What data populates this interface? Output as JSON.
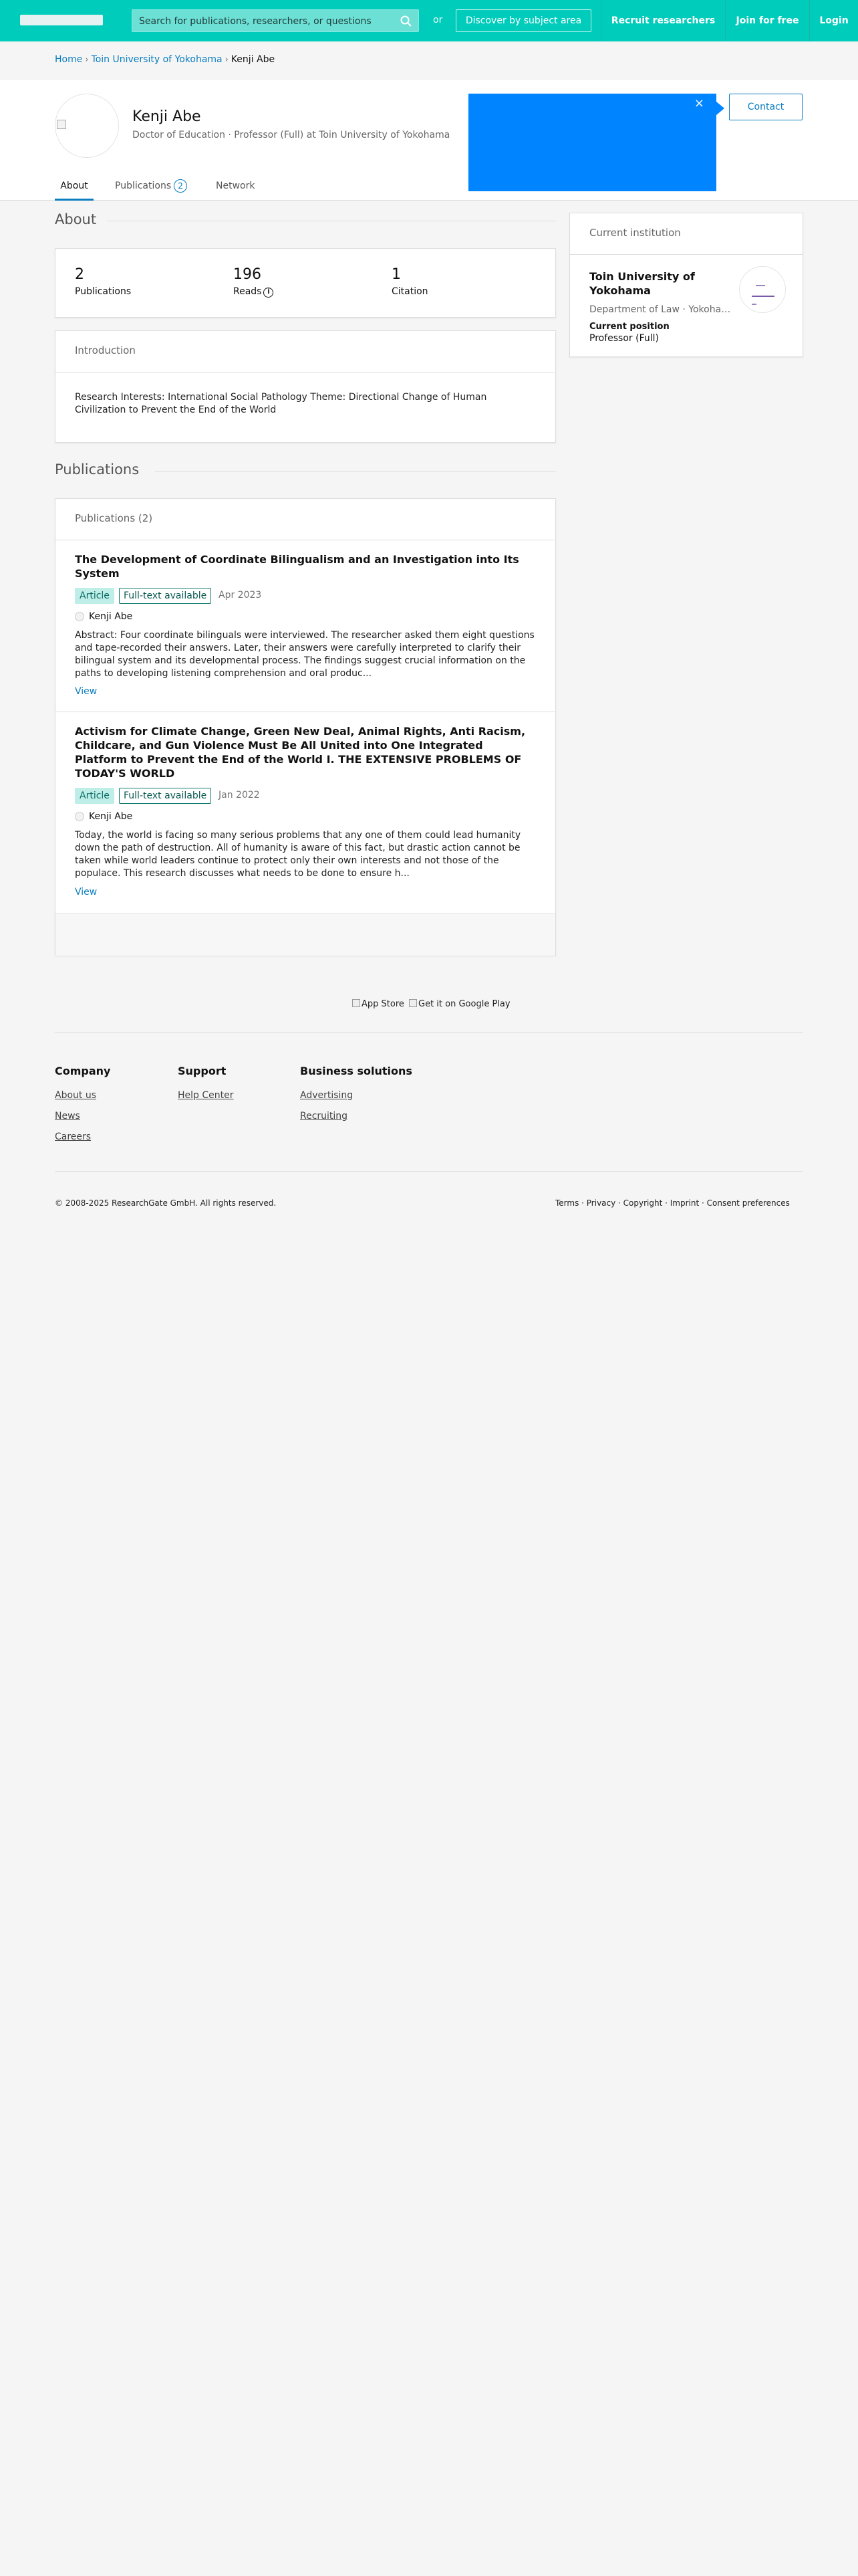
{
  "header": {
    "search_placeholder": "Search for publications, researchers, or questions",
    "or_label": "or",
    "discover_label": "Discover by subject area",
    "recruit_label": "Recruit researchers",
    "join_label": "Join for free",
    "login_label": "Login"
  },
  "breadcrumb": {
    "home": "Home",
    "institution": "Toin University of Yokohama",
    "current": "Kenji Abe"
  },
  "profile": {
    "name": "Kenji Abe",
    "subtitle": "Doctor of Education · Professor (Full) at Toin University of Yokohama",
    "contact_label": "Contact",
    "ad_close": "×",
    "tabs": {
      "about": "About",
      "publications": "Publications",
      "publications_count": "2",
      "network": "Network"
    }
  },
  "about": {
    "title": "About",
    "stats": [
      {
        "value": "2",
        "label": "Publications"
      },
      {
        "value": "196",
        "label": "Reads"
      },
      {
        "value": "1",
        "label": "Citation"
      }
    ],
    "info_icon": "i",
    "introduction_title": "Introduction",
    "introduction_text": "Research Interests: International Social Pathology Theme: Directional Change of Human Civilization to Prevent the End of the World"
  },
  "publications": {
    "section_title": "Publications",
    "card_title": "Publications (2)",
    "items": [
      {
        "title": "The Development of Coordinate Bilingualism and an Investigation into Its System",
        "type": "Article",
        "fulltext": "Full-text available",
        "date": "Apr 2023",
        "author": "Kenji Abe",
        "abstract": "Abstract: Four coordinate bilinguals were interviewed. The researcher asked them eight questions and tape-recorded their answers. Later, their answers were carefully interpreted to clarify their bilingual system and its developmental process. The findings suggest crucial information on the paths to developing listening comprehension and oral produc...",
        "view_label": "View"
      },
      {
        "title": "Activism for Climate Change, Green New Deal, Animal Rights, Anti Racism, Childcare, and Gun Violence Must Be All United into One Integrated Platform to Prevent the End of the World I. THE EXTENSIVE PROBLEMS OF TODAY'S WORLD",
        "type": "Article",
        "fulltext": "Full-text available",
        "date": "Jan 2022",
        "author": "Kenji Abe",
        "abstract": "Today, the world is facing so many serious problems that any one of them could lead humanity down the path of destruction. All of humanity is aware of this fact, but drastic action cannot be taken while world leaders continue to protect only their own interests and not those of the populace. This research discusses what needs to be done to ensure h...",
        "view_label": "View"
      }
    ]
  },
  "institution": {
    "card_title": "Current institution",
    "name": "Toin University of Yokohama",
    "department": "Department of Law · Yokohama, Japan",
    "position_label": "Current position",
    "position": "Professor (Full)"
  },
  "footer": {
    "app_store": "App Store",
    "google_play": "Get it on Google Play",
    "company_title": "Company",
    "company_links": [
      "About us",
      "News",
      "Careers"
    ],
    "support_title": "Support",
    "support_links": [
      "Help Center"
    ],
    "business_title": "Business solutions",
    "business_links": [
      "Advertising",
      "Recruiting"
    ],
    "copyright": "© 2008-2025 ResearchGate GmbH. All rights reserved.",
    "legal": "Terms · Privacy · Copyright · Imprint · Consent preferences"
  }
}
